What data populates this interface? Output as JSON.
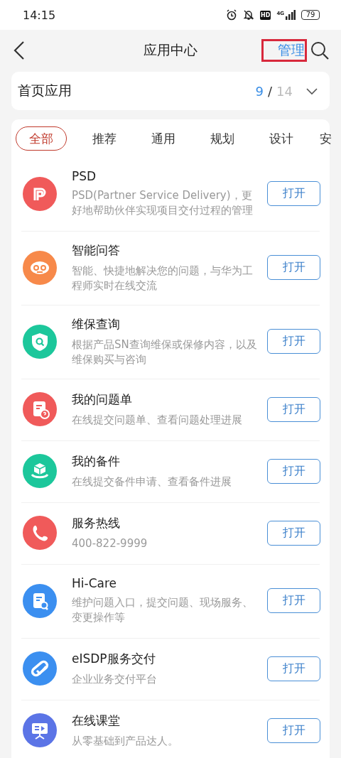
{
  "status_bar": {
    "time": "14:15",
    "hd": "HD",
    "network": "4G",
    "battery": "79"
  },
  "header": {
    "title": "应用中心",
    "manage": {
      "label": "管理",
      "highlighted": true
    }
  },
  "home_apps": {
    "label": "首页应用",
    "count": "9",
    "separator": "/",
    "total": "14",
    "expanded": false
  },
  "tabs": [
    {
      "label": "全部",
      "selected": true
    },
    {
      "label": "推荐",
      "selected": false
    },
    {
      "label": "通用",
      "selected": false
    },
    {
      "label": "规划",
      "selected": false
    },
    {
      "label": "设计",
      "selected": false
    },
    {
      "label": "安",
      "selected": false
    }
  ],
  "apps": [
    {
      "name": "PSD",
      "description": "PSD(Partner Service Delivery)，更好地帮助伙伴实现项目交付过程的管理",
      "button": "打开",
      "color": "#f05a5a"
    },
    {
      "name": "智能问答",
      "description": "智能、快捷地解决您的问题，与华为工程师实时在线交流",
      "button": "打开",
      "color": "#f7894a"
    },
    {
      "name": "维保查询",
      "description": "根据产品SN查询维保或保修内容，以及维保购买与咨询",
      "button": "打开",
      "color": "#1cc79b"
    },
    {
      "name": "我的问题单",
      "description": "在线提交问题单、查看问题处理进展",
      "button": "打开",
      "color": "#f05a5a"
    },
    {
      "name": "我的备件",
      "description": "在线提交备件申请、查看备件进展",
      "button": "打开",
      "color": "#1cc79b"
    },
    {
      "name": "服务热线",
      "description": "400-822-9999",
      "button": "打开",
      "color": "#f05a5a"
    },
    {
      "name": "Hi-Care",
      "description": "维护问题入口，提交问题、现场服务、变更操作等",
      "button": "打开",
      "color": "#3b8ff0"
    },
    {
      "name": "eISDP服务交付",
      "description": "企业业务交付平台",
      "button": "打开",
      "color": "#3b8ff0"
    },
    {
      "name": "在线课堂",
      "description": "从零基础到产品达人。",
      "button": "打开",
      "color": "#5b74e6"
    }
  ]
}
